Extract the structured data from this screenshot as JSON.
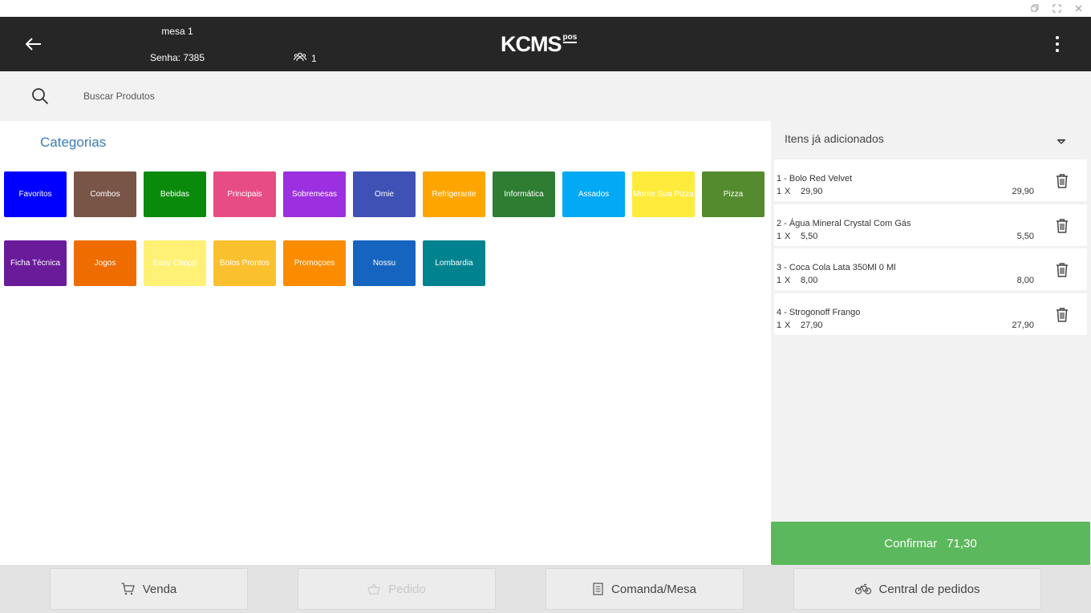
{
  "header": {
    "mesa": "mesa 1",
    "senha": "Senha: 7385",
    "people_count": "1",
    "logo_text": "KCMS",
    "logo_sub": "pos"
  },
  "search": {
    "placeholder": "Buscar Produtos"
  },
  "categories": {
    "title": "Categorias",
    "items": [
      {
        "label": "Favoritos",
        "color": "#0000ff"
      },
      {
        "label": "Combos",
        "color": "#795548"
      },
      {
        "label": "Bebidas",
        "color": "#0a8a0a"
      },
      {
        "label": "Principais",
        "color": "#e84c85"
      },
      {
        "label": "Sobremesas",
        "color": "#9c2fe0"
      },
      {
        "label": "Omie",
        "color": "#3f51b5"
      },
      {
        "label": "Refrigerante",
        "color": "#ffa500"
      },
      {
        "label": "Informática",
        "color": "#2e7d32"
      },
      {
        "label": "Assados",
        "color": "#03a9f4"
      },
      {
        "label": "Monte Sua Pizza",
        "color": "#ffeb3b"
      },
      {
        "label": "Pizza",
        "color": "#558b2f"
      },
      {
        "label": "Ficha Técnica",
        "color": "#6a1b9a"
      },
      {
        "label": "Jogos",
        "color": "#ef6c00"
      },
      {
        "label": "Easy Chopp",
        "color": "#fff176"
      },
      {
        "label": "Bolos Prontos",
        "color": "#fbc02d"
      },
      {
        "label": "Promoçoes",
        "color": "#fb8c00"
      },
      {
        "label": "Nossu",
        "color": "#1565c0"
      },
      {
        "label": "Lombardia",
        "color": "#00838f"
      }
    ]
  },
  "added_items": {
    "title": "Itens já adicionados",
    "items": [
      {
        "name": "1 - Bolo Red Velvet",
        "qty": "1",
        "x": "X",
        "unit": "29,90",
        "total": "29,90"
      },
      {
        "name": "2 - Água Mineral Crystal Com Gás",
        "qty": "1",
        "x": "X",
        "unit": "5,50",
        "total": "5,50"
      },
      {
        "name": "3 - Coca Cola Lata 350Ml 0 Ml",
        "qty": "1",
        "x": "X",
        "unit": "8,00",
        "total": "8,00"
      },
      {
        "name": "4 - Strogonoff Frango",
        "qty": "1",
        "x": "X",
        "unit": "27,90",
        "total": "27,90"
      }
    ]
  },
  "confirm": {
    "label": "Confirmar",
    "total": "71,30",
    "color": "#5cb85c"
  },
  "bottom_nav": {
    "venda": "Venda",
    "pedido": "Pedido",
    "comanda": "Comanda/Mesa",
    "central": "Central de pedidos"
  }
}
